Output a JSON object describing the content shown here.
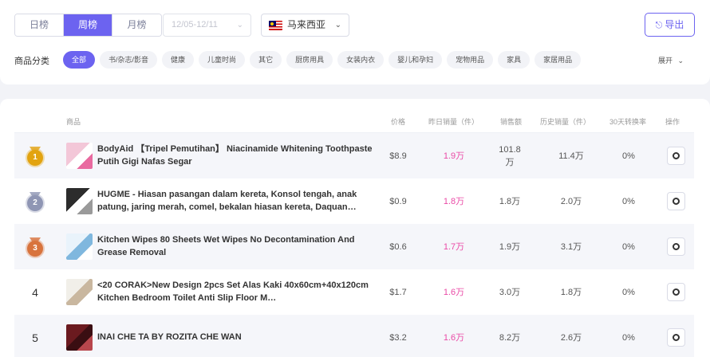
{
  "period_tabs": [
    {
      "label": "日榜",
      "active": false
    },
    {
      "label": "周榜",
      "active": true
    },
    {
      "label": "月榜",
      "active": false
    }
  ],
  "date_range": {
    "value": "12/05-12/11"
  },
  "country": {
    "name": "马来西亚",
    "flag_icon": "malaysia-flag-icon"
  },
  "export": {
    "label": "导出",
    "icon": "export-icon"
  },
  "category": {
    "label": "商品分类",
    "items": [
      {
        "label": "全部",
        "active": true
      },
      {
        "label": "书/杂志/影音",
        "active": false
      },
      {
        "label": "健康",
        "active": false
      },
      {
        "label": "儿童时尚",
        "active": false
      },
      {
        "label": "其它",
        "active": false
      },
      {
        "label": "厨房用具",
        "active": false
      },
      {
        "label": "女装内衣",
        "active": false
      },
      {
        "label": "婴儿和孕妇",
        "active": false
      },
      {
        "label": "宠物用品",
        "active": false
      },
      {
        "label": "家具",
        "active": false
      },
      {
        "label": "家居用品",
        "active": false
      }
    ],
    "expand_label": "展开"
  },
  "table": {
    "headers": {
      "product": "商品",
      "price": "价格",
      "yesterday_sales": "昨日销量（件）",
      "sales_amount": "销售额",
      "total_sales": "历史销量（件）",
      "conversion": "30天转换率",
      "action": "操作"
    },
    "rows": [
      {
        "rank": "1",
        "medal": "gold",
        "name": "BodyAid 【Tripel Pemutihan】 Niacinamide Whitening Toothpaste Putih Gigi Nafas Segar",
        "price": "$8.9",
        "yesterday_sales": "1.9万",
        "sales_amount_line1": "101.8",
        "sales_amount_line2": "万",
        "total_sales": "11.4万",
        "conversion": "0%",
        "thumb_colors": [
          "#f3c7d8",
          "#ffffff",
          "#e96aa0"
        ]
      },
      {
        "rank": "2",
        "medal": "silver",
        "name": "HUGME - Hiasan pasangan dalam kereta, Konsol tengah, anak patung, jaring merah, comel, bekalan hiasan kereta, Daquan…",
        "price": "$0.9",
        "yesterday_sales": "1.8万",
        "sales_amount_line1": "1.8万",
        "sales_amount_line2": "",
        "total_sales": "2.0万",
        "conversion": "0%",
        "thumb_colors": [
          "#2c2c2c",
          "#ffffff",
          "#9a9a9a"
        ]
      },
      {
        "rank": "3",
        "medal": "bronze",
        "name": "Kitchen Wipes 80 Sheets Wet Wipes No Decontamination And Grease Removal",
        "price": "$0.6",
        "yesterday_sales": "1.7万",
        "sales_amount_line1": "1.9万",
        "sales_amount_line2": "",
        "total_sales": "3.1万",
        "conversion": "0%",
        "thumb_colors": [
          "#e9f3fb",
          "#7fb7de",
          "#ffffff"
        ]
      },
      {
        "rank": "4",
        "medal": "",
        "name": "<20 CORAK>New Design 2pcs Set Alas Kaki 40x60cm+40x120cm Kitchen Bedroom Toilet Anti Slip Floor M…",
        "price": "$1.7",
        "yesterday_sales": "1.6万",
        "sales_amount_line1": "3.0万",
        "sales_amount_line2": "",
        "total_sales": "1.8万",
        "conversion": "0%",
        "thumb_colors": [
          "#f1efe9",
          "#c9b79f",
          "#ffffff"
        ]
      },
      {
        "rank": "5",
        "medal": "",
        "name": "INAI CHE TA BY ROZITA CHE WAN",
        "price": "$3.2",
        "yesterday_sales": "1.6万",
        "sales_amount_line1": "8.2万",
        "sales_amount_line2": "",
        "total_sales": "2.6万",
        "conversion": "0%",
        "thumb_colors": [
          "#6b1a1f",
          "#3a0e12",
          "#b8464c"
        ]
      }
    ]
  },
  "colors": {
    "accent": "#6c63f0",
    "pink_value": "#ea4aa6",
    "gold": "#e2a310",
    "silver": "#8f96b4",
    "bronze": "#d8733d"
  }
}
